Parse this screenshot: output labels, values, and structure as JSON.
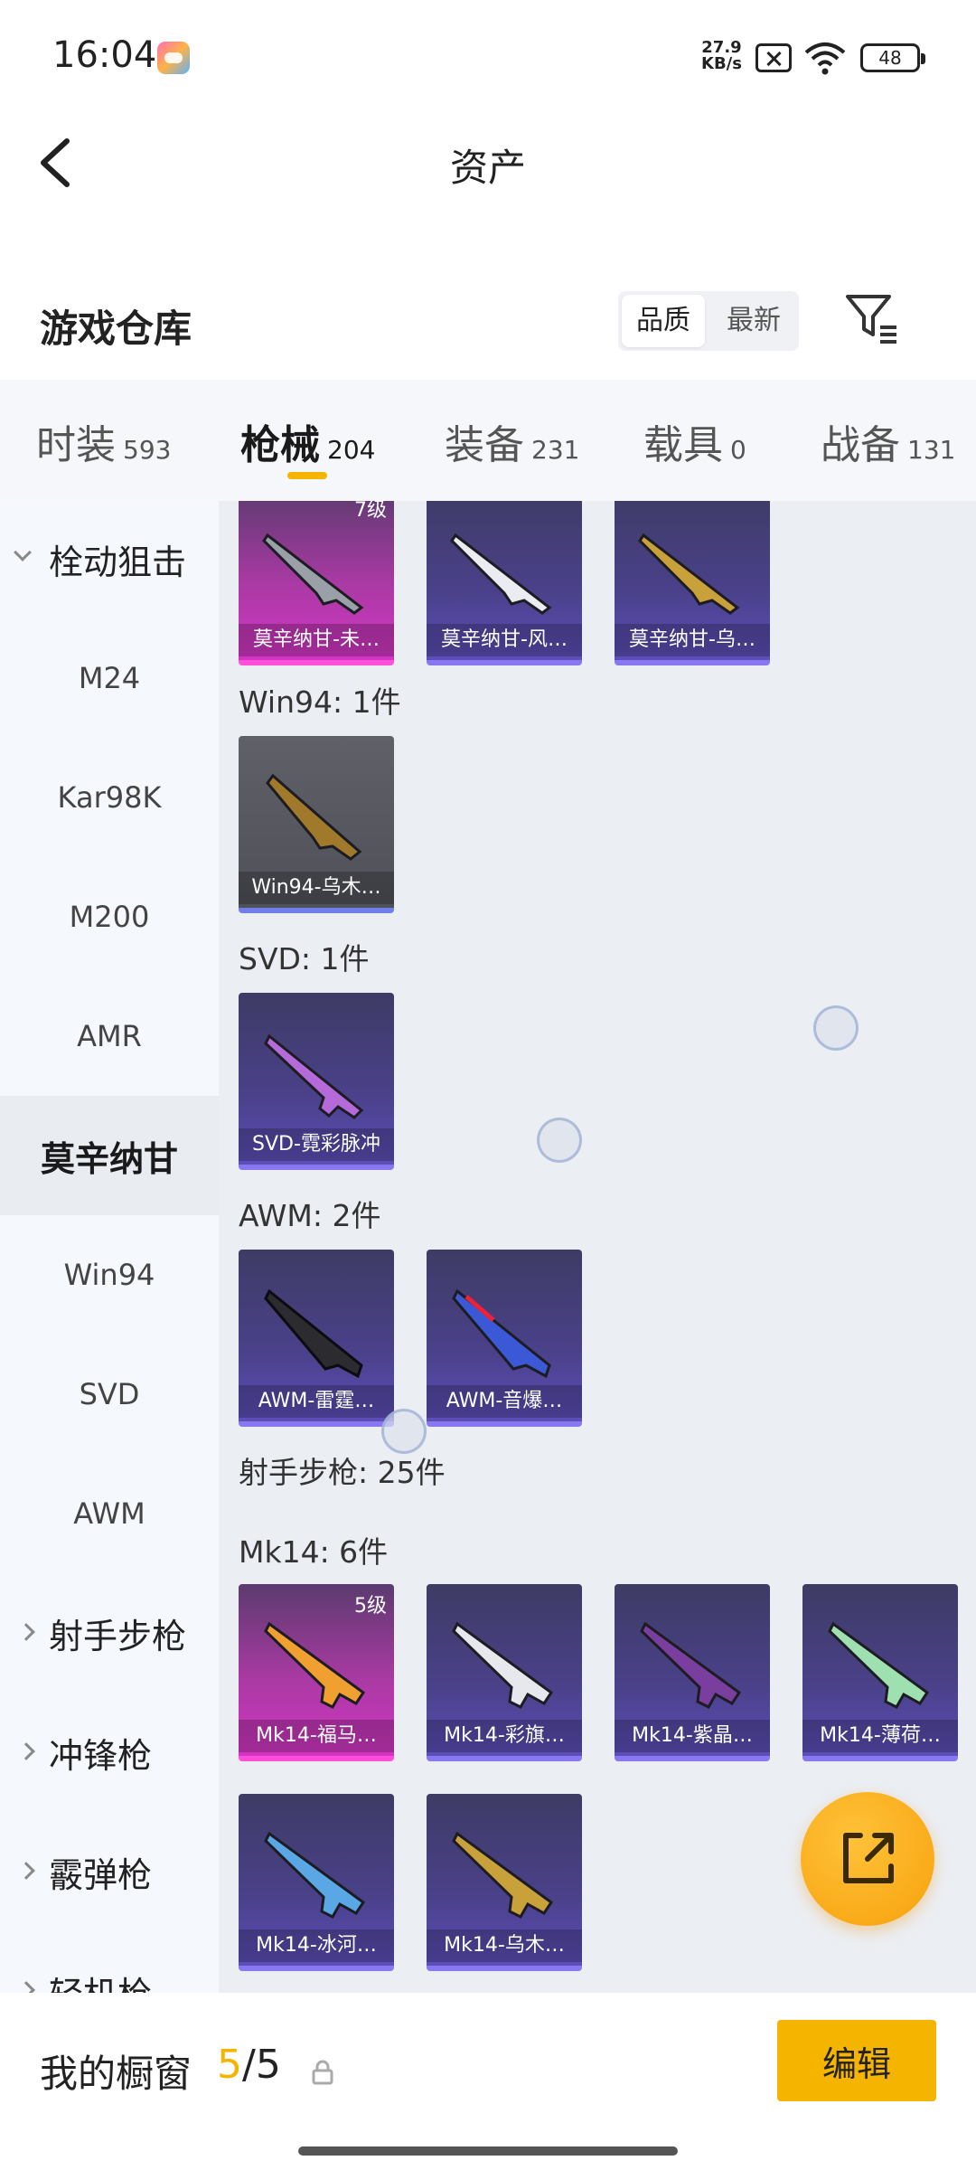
{
  "status_bar": {
    "time": "16:04",
    "net_speed_value": "27.9",
    "net_speed_unit": "KB/s",
    "battery": "48"
  },
  "header": {
    "title": "资产"
  },
  "warehouse": {
    "title": "游戏仓库",
    "sort_options": [
      "品质",
      "最新"
    ],
    "active_sort": "品质"
  },
  "tabs": [
    {
      "label": "时装",
      "count": "593"
    },
    {
      "label": "枪械",
      "count": "204",
      "active": true
    },
    {
      "label": "装备",
      "count": "231"
    },
    {
      "label": "载具",
      "count": "0"
    },
    {
      "label": "战备",
      "count": "131"
    }
  ],
  "sidebar": {
    "items": [
      {
        "label": "栓动狙击",
        "type": "group-open"
      },
      {
        "label": "M24"
      },
      {
        "label": "Kar98K"
      },
      {
        "label": "M200"
      },
      {
        "label": "AMR"
      },
      {
        "label": "莫辛纳甘",
        "selected": true
      },
      {
        "label": "Win94"
      },
      {
        "label": "SVD"
      },
      {
        "label": "AWM"
      },
      {
        "label": "射手步枪",
        "type": "group"
      },
      {
        "label": "冲锋枪",
        "type": "group"
      },
      {
        "label": "霰弹枪",
        "type": "group"
      },
      {
        "label": "轻机枪",
        "type": "group"
      }
    ]
  },
  "content": {
    "mosin_cards": [
      {
        "name": "莫辛纳甘-未…",
        "level": "7级",
        "rarity": "pink"
      },
      {
        "name": "莫辛纳甘-风…",
        "rarity": "purple"
      },
      {
        "name": "莫辛纳甘-乌…",
        "rarity": "purple"
      }
    ],
    "win94_label": "Win94: 1件",
    "win94_cards": [
      {
        "name": "Win94-乌木…",
        "rarity": "grey"
      }
    ],
    "svd_label": "SVD: 1件",
    "svd_cards": [
      {
        "name": "SVD-霓彩脉冲",
        "rarity": "purple"
      }
    ],
    "awm_label": "AWM: 2件",
    "awm_cards": [
      {
        "name": "AWM-雷霆…",
        "rarity": "purple"
      },
      {
        "name": "AWM-音爆…",
        "rarity": "purple"
      }
    ],
    "dmr_label": "射手步枪: 25件",
    "mk14_label": "Mk14: 6件",
    "mk14_cards": [
      {
        "name": "Mk14-福马…",
        "level": "5级",
        "rarity": "pink"
      },
      {
        "name": "Mk14-彩旗…",
        "rarity": "purple"
      },
      {
        "name": "Mk14-紫晶…",
        "rarity": "purple"
      },
      {
        "name": "Mk14-薄荷…",
        "rarity": "purple"
      },
      {
        "name": "Mk14-冰河…",
        "rarity": "purple"
      },
      {
        "name": "Mk14-乌木…",
        "rarity": "purple"
      }
    ]
  },
  "showcase": {
    "label": "我的橱窗",
    "current": "5",
    "total": "/5",
    "edit_label": "编辑"
  },
  "colors": {
    "accent": "#f5b400",
    "pink_rarity": "#d235c3",
    "purple_rarity": "#5c4eb8"
  }
}
